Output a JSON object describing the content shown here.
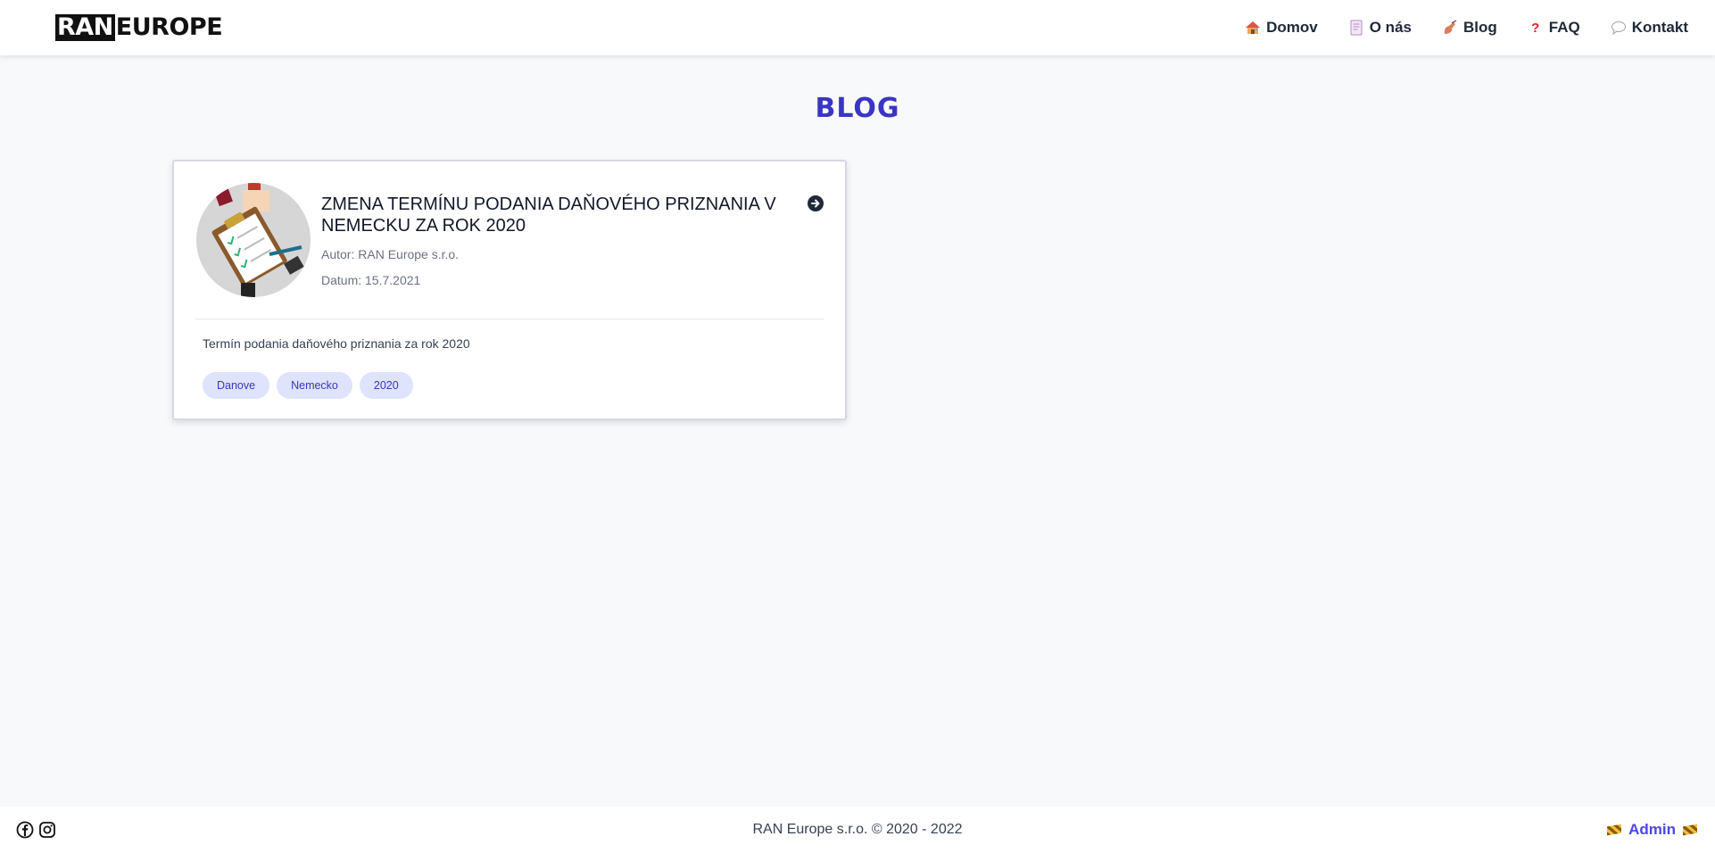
{
  "header": {
    "logo": {
      "part1": "RAN",
      "part2": "EUROPE"
    },
    "nav": [
      {
        "label": "Domov",
        "icon": "house-icon"
      },
      {
        "label": "O nás",
        "icon": "document-icon"
      },
      {
        "label": "Blog",
        "icon": "writing-hand-icon"
      },
      {
        "label": "FAQ",
        "icon": "question-mark-icon"
      },
      {
        "label": "Kontakt",
        "icon": "speech-bubble-icon"
      }
    ]
  },
  "page": {
    "title": "BLOG"
  },
  "posts": [
    {
      "title": "ZMENA TERMÍNU PODANIA DAŇOVÉHO PRIZNANIA V NEMECKU ZA ROK 2020",
      "author": "Autor: RAN Europe s.r.o.",
      "date": "Datum: 15.7.2021",
      "excerpt": "Termín podania daňového priznania za rok 2020",
      "tags": [
        "Danove",
        "Nemecko",
        "2020"
      ],
      "image_icon": "clipboard-checklist-illustration"
    }
  ],
  "footer": {
    "copyright": "RAN Europe s.r.o. © 2020 - 2022",
    "admin_label": "Admin",
    "social": [
      "facebook-icon",
      "instagram-icon"
    ]
  },
  "colors": {
    "accent": "#3b35c4",
    "tag_bg": "#dfe3fb",
    "admin": "#4f46e5"
  }
}
